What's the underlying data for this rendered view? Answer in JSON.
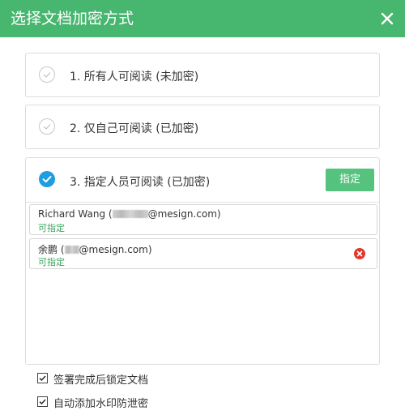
{
  "dialog": {
    "title": "选择文档加密方式",
    "close_icon": "close-icon"
  },
  "options": [
    {
      "label": "1. 所有人可阅读 (未加密)",
      "selected": false
    },
    {
      "label": "2. 仅自己可阅读 (已加密)",
      "selected": false
    },
    {
      "label": "3. 指定人员可阅读 (已加密)",
      "selected": true,
      "assign_button": "指定"
    }
  ],
  "recipients": [
    {
      "name": "Richard Wang (",
      "email_suffix": "@mesign.com)",
      "permission": "可指定",
      "removable": false
    },
    {
      "name": "余鹏 (",
      "email_suffix": "@mesign.com)",
      "permission": "可指定",
      "removable": true
    }
  ],
  "checkboxes": [
    {
      "label": "签署完成后锁定文档",
      "checked": true
    },
    {
      "label": "自动添加水印防泄密",
      "checked": true
    }
  ],
  "colors": {
    "header": "#47b66f",
    "accent_blue": "#1e9ee0",
    "button_green": "#55c27d",
    "remove_red": "#e0392b"
  }
}
